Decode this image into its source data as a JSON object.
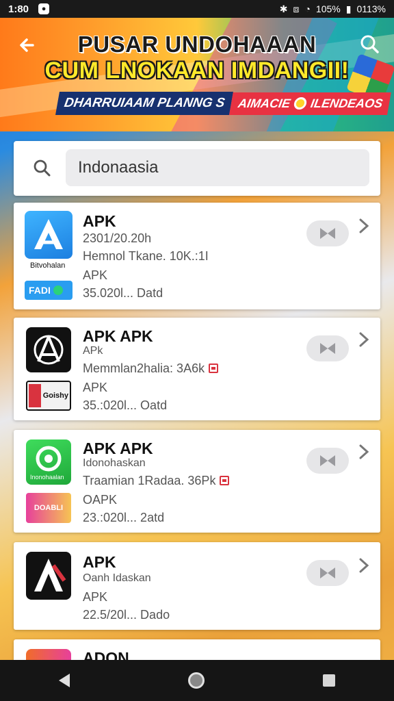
{
  "status_bar": {
    "time": "1:80",
    "battery_text": "0113%",
    "signal_text": "105%"
  },
  "banner": {
    "line1": "PUSAR UNDOHAAAN",
    "line2": "CUM LNOKAAN IMDANGII!",
    "ribbon_left": "DHARRUIAAM PLANNG S",
    "ribbon_right_a": "AIMACIE",
    "ribbon_right_b": "ILENDEAOS"
  },
  "search": {
    "value": "Indonaasia"
  },
  "apps": [
    {
      "title": "APK",
      "line1": "2301/20.20h",
      "line2": "Hemnol Tkane. 10K.:1I",
      "line3": "APK",
      "line4": "35.020l... Datd",
      "icon_caption": "Bitvohalan",
      "sub_label": "FADI"
    },
    {
      "title": "APK APK",
      "line1": "APk",
      "line2": "Memmlan2halia: 3A6k",
      "line3": "APK",
      "line4": "35.:020l... Oatd",
      "icon_caption": "",
      "sub_label": "Goishy"
    },
    {
      "title": "APK APK",
      "line1": "Idonohaskan",
      "line2": "Traamian 1Radaa. 36Pk",
      "line3": "OAPK",
      "line4": "23.:020l... 2atd",
      "icon_caption": "Inonohaalan",
      "sub_label": "DOABLI"
    },
    {
      "title": "APK",
      "line1": "Oanh Idaskan",
      "line2": "",
      "line3": "APK",
      "line4": "22.5/20l... Dado",
      "icon_caption": "",
      "sub_label": ""
    },
    {
      "title": "ADON",
      "line1": "",
      "line2": "",
      "line3": "",
      "line4": "",
      "icon_caption": "",
      "sub_label": ""
    }
  ],
  "colors": {
    "accent_yellow": "#ffe92a",
    "ribbon_navy": "#17316f",
    "ribbon_red": "#e83242",
    "blue_app": "#2a9df0",
    "green_app": "#27c24a"
  }
}
